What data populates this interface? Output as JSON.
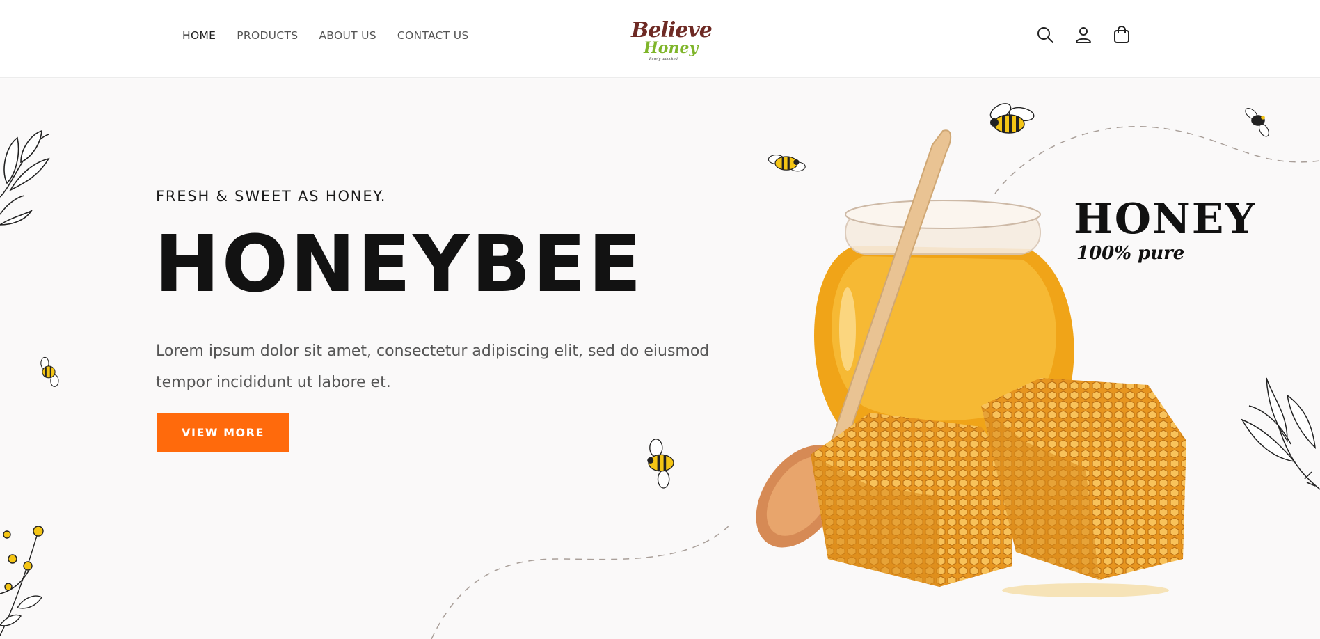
{
  "nav": {
    "items": [
      {
        "label": "HOME",
        "active": true
      },
      {
        "label": "PRODUCTS",
        "active": false
      },
      {
        "label": "ABOUT US",
        "active": false
      },
      {
        "label": "CONTACT US",
        "active": false
      }
    ]
  },
  "logo": {
    "line1": "Believe",
    "line2": "Honey",
    "line3": "Purely unlocked"
  },
  "header_icons": [
    "search-icon",
    "account-icon",
    "cart-icon"
  ],
  "hero": {
    "tagline": "FRESH & SWEET AS HONEY.",
    "title": "HONEYBEE",
    "description": "Lorem ipsum dolor sit amet, consectetur adipiscing elit, sed do eiusmod tempor incididunt ut labore et.",
    "button_label": "VIEW MORE",
    "badge_line1": "HONEY",
    "badge_line2": "100% pure"
  },
  "colors": {
    "accent": "#ff6a0c",
    "logo_brown": "#6e2a24",
    "logo_green": "#7fb52a",
    "honey": "#f2a51d"
  }
}
